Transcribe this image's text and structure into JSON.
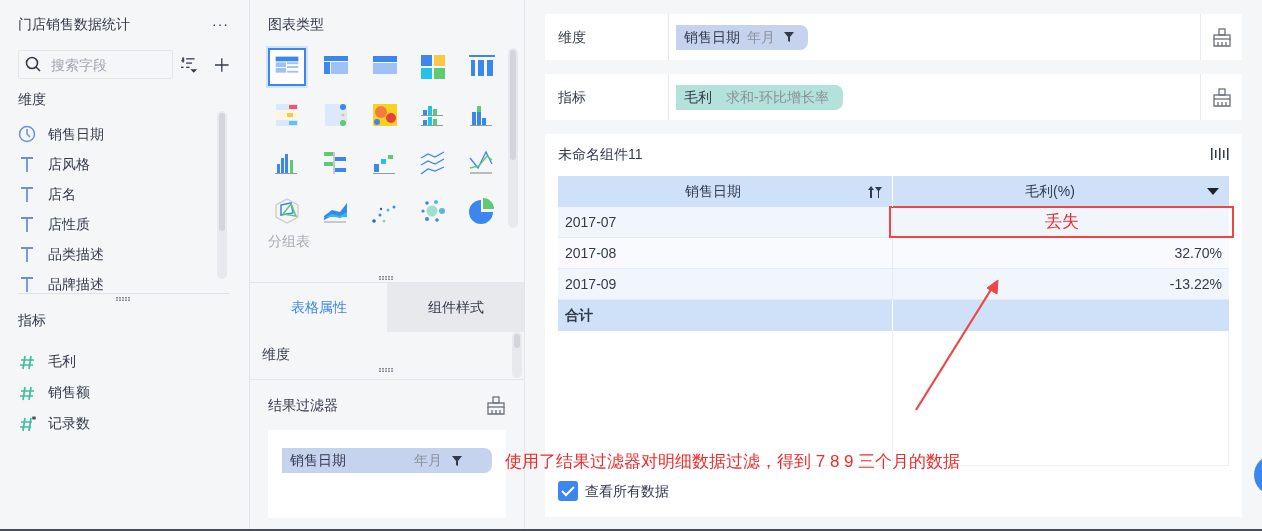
{
  "left_panel": {
    "title": "门店销售数据统计",
    "menu": "···",
    "search": {
      "placeholder": "搜索字段"
    },
    "dimensions": {
      "title": "维度",
      "items": [
        {
          "kind": "time",
          "label": "销售日期"
        },
        {
          "kind": "text",
          "label": "店风格"
        },
        {
          "kind": "text",
          "label": "店名"
        },
        {
          "kind": "text",
          "label": "店性质"
        },
        {
          "kind": "text",
          "label": "品类描述"
        },
        {
          "kind": "text",
          "label": "品牌描述"
        }
      ]
    },
    "measures": {
      "title": "指标",
      "items": [
        {
          "kind": "number",
          "label": "毛利"
        },
        {
          "kind": "number",
          "label": "销售额"
        },
        {
          "kind": "count",
          "label": "记录数"
        }
      ]
    }
  },
  "chart_panel": {
    "title": "图表类型",
    "types": [
      {
        "kind": "grouptable",
        "selected": true
      },
      {
        "kind": "crosstable",
        "selected": false
      },
      {
        "kind": "detailtable",
        "selected": false
      },
      {
        "kind": "colortable",
        "selected": false
      },
      {
        "kind": "kpi",
        "selected": false
      },
      {
        "kind": "kpilist",
        "selected": false
      },
      {
        "kind": "kpidot",
        "selected": false
      },
      {
        "kind": "heatmap",
        "selected": false
      },
      {
        "kind": "groupbar",
        "selected": false
      },
      {
        "kind": "stackbar",
        "selected": false
      },
      {
        "kind": "bar",
        "selected": false
      },
      {
        "kind": "rangebar",
        "selected": false
      },
      {
        "kind": "waterfall",
        "selected": false
      },
      {
        "kind": "line",
        "selected": false
      },
      {
        "kind": "crossline",
        "selected": false
      },
      {
        "kind": "radar",
        "selected": false
      },
      {
        "kind": "area",
        "selected": false
      },
      {
        "kind": "scatter",
        "selected": false
      },
      {
        "kind": "bubble",
        "selected": false
      },
      {
        "kind": "pie",
        "selected": false
      }
    ],
    "selected_label": "分组表",
    "tabs": [
      {
        "label": "表格属性",
        "selected": true
      },
      {
        "label": "组件样式",
        "selected": false
      }
    ],
    "dimension_label": "维度",
    "result_filter": {
      "title": "结果过滤器",
      "pill": {
        "field": "销售日期",
        "granularity": "年月"
      }
    }
  },
  "editor": {
    "dimension_row": {
      "label": "维度",
      "pill": {
        "field": "销售日期",
        "granularity": "年月"
      }
    },
    "measure_row": {
      "label": "指标",
      "pill": {
        "field": "毛利",
        "aggregation": "求和-环比增长率"
      }
    },
    "widget": {
      "title": "未命名组件11",
      "table": {
        "columns": [
          "销售日期",
          "毛利(%)"
        ],
        "rows": [
          {
            "cells": [
              "2017-07",
              "丢失"
            ],
            "highlighted": true
          },
          {
            "cells": [
              "2017-08",
              "32.70%"
            ],
            "highlighted": false
          },
          {
            "cells": [
              "2017-09",
              "-13.22%"
            ],
            "highlighted": false
          }
        ],
        "total": "合计"
      },
      "view_all": {
        "label": "查看所有数据",
        "checked": true
      }
    }
  },
  "annotation": "使用了结果过滤器对明细数据过滤，得到 7 8 9 三个月的数据"
}
